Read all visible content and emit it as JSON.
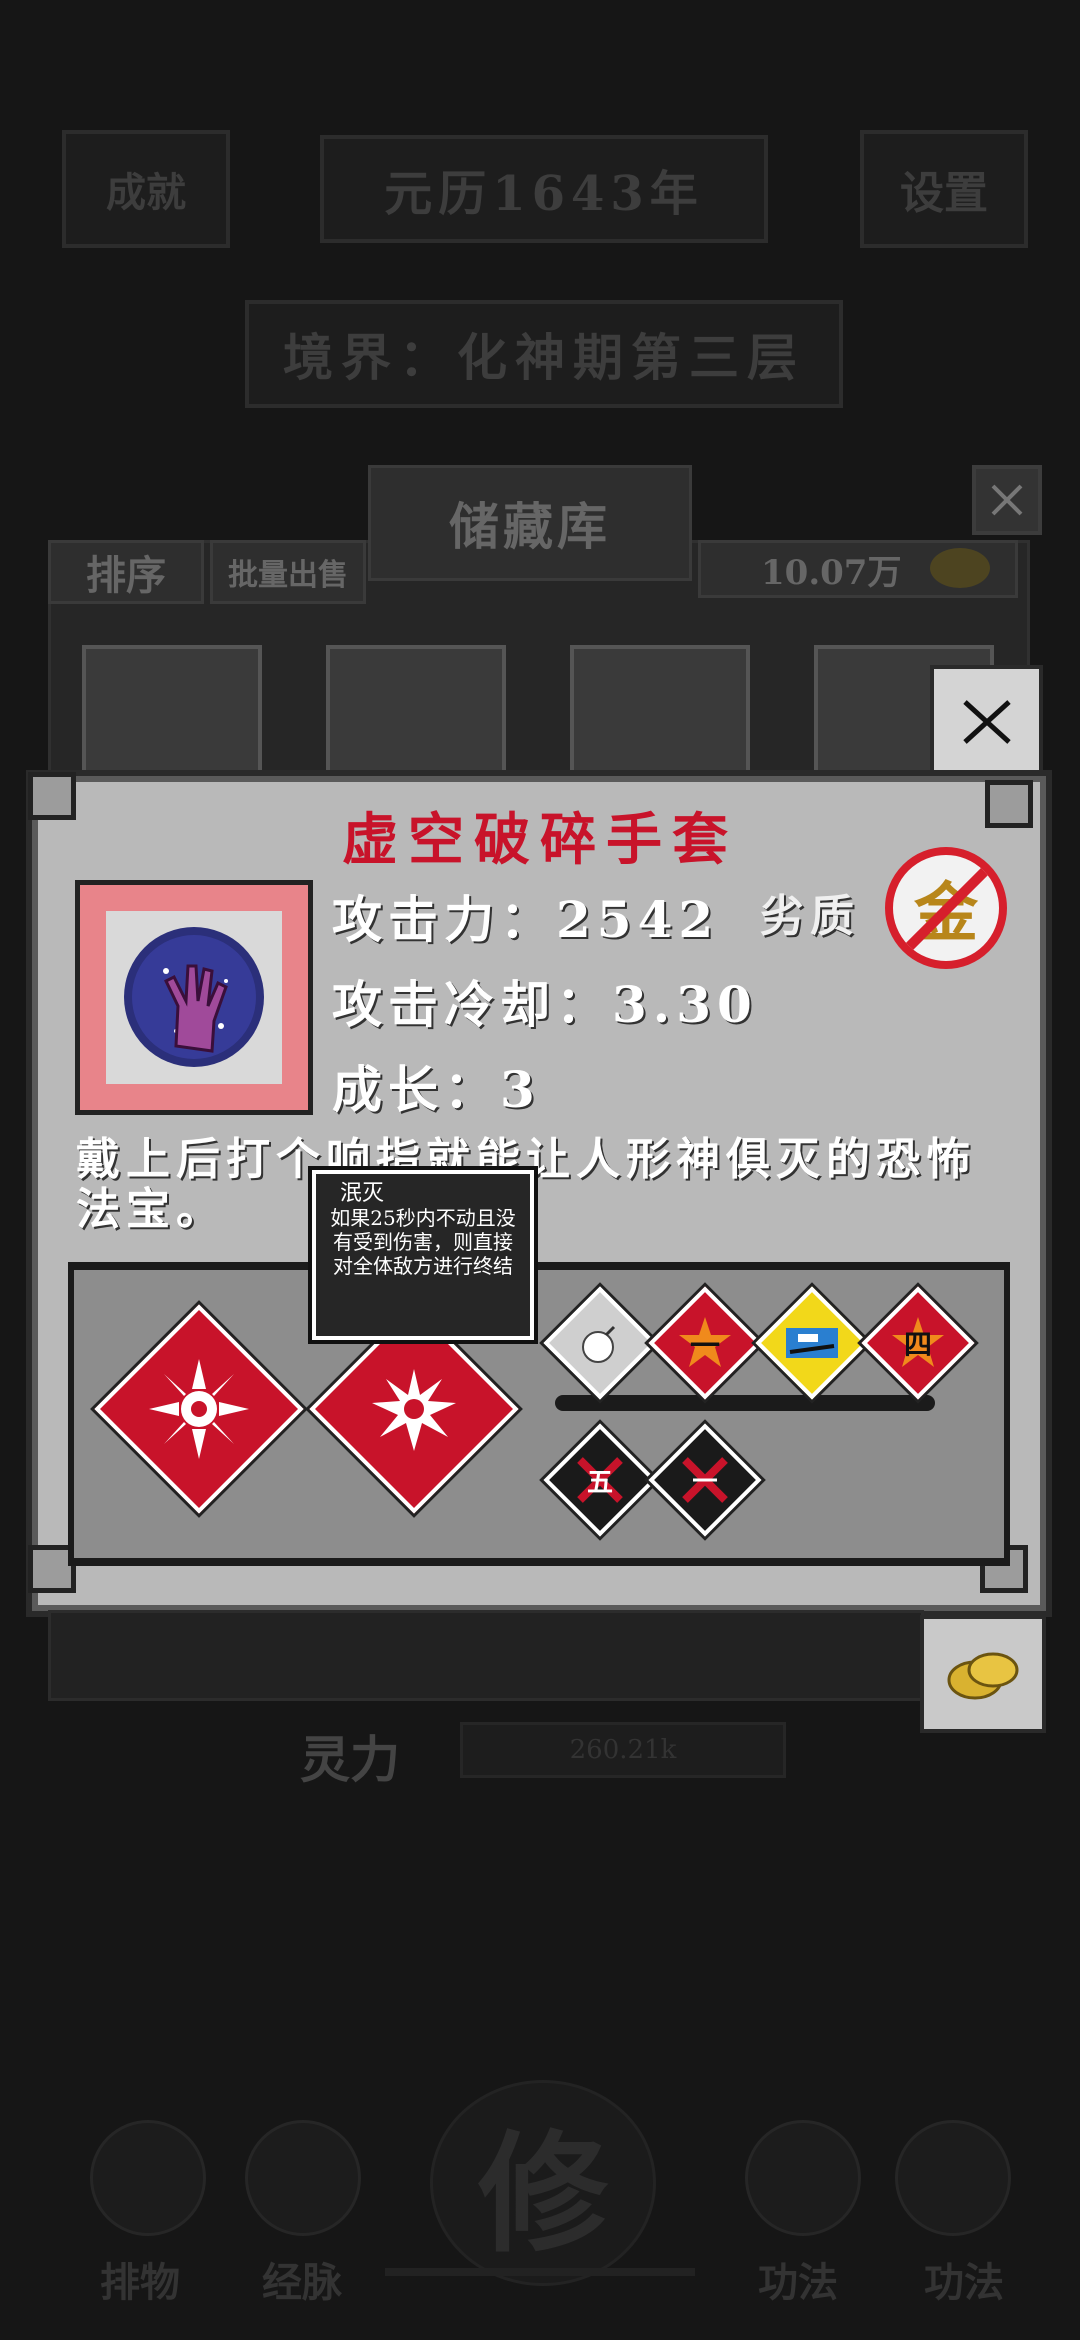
{
  "header": {
    "left_button": "成就",
    "era": "元历1643年",
    "settings": "设置",
    "realm": "境界：化神期第三层"
  },
  "storage": {
    "title": "储藏库",
    "sort_label": "排序",
    "bulk_sell_label": "批量出售",
    "gold_amount": "10.07万",
    "power_label": "灵力",
    "power_value": "260.21k"
  },
  "item": {
    "name": "虚空破碎手套",
    "attack": "攻击力：2542",
    "quality_label": "劣质",
    "grade_char": "金",
    "cooldown": "攻击冷却：3.30",
    "growth": "成长：3",
    "description": "戴上后打个响指就能让人形神俱灭的恐怖法宝。"
  },
  "tooltip": {
    "title": "泯灭",
    "body": "如果25秒内不动且没有受到伤害，则直接对全体敌方进行终结"
  },
  "skill_badges": {
    "badge_one": "一",
    "badge_four": "四",
    "badge_five": "五"
  },
  "nav": {
    "items": [
      "排物",
      "经脉",
      "修",
      "功法",
      "功法"
    ]
  },
  "colors": {
    "accent_red": "#c8132a",
    "panel_gray": "#b9b9b9",
    "gold": "#d9b230"
  },
  "icons": [
    "gear-icon",
    "close-icon",
    "coin-icon",
    "bomb-icon",
    "star-icon",
    "gauntlet-icon",
    "snowflake-icon",
    "burst-icon"
  ]
}
